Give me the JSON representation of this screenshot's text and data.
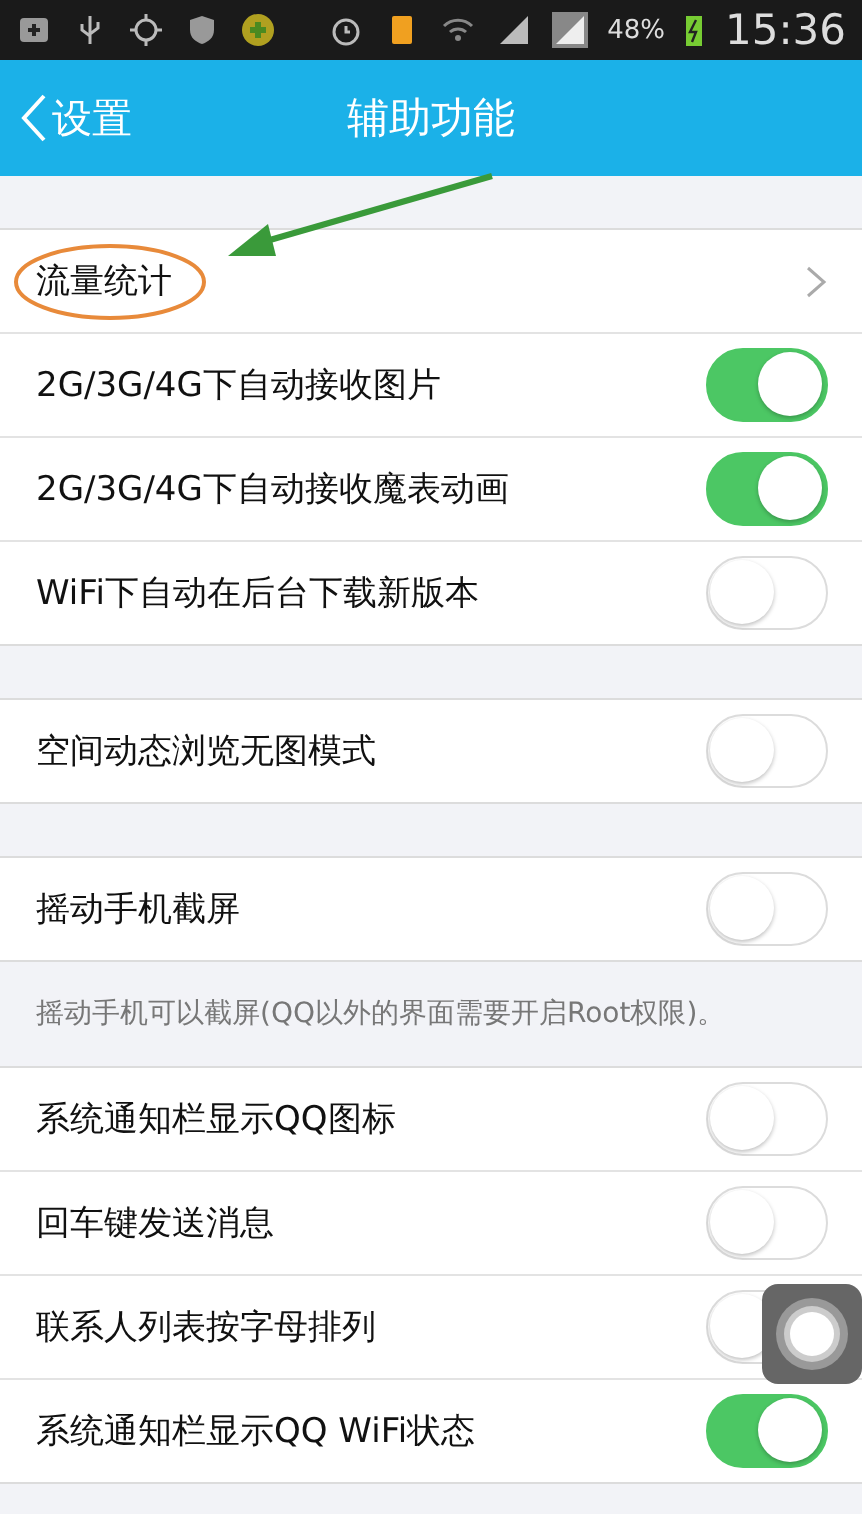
{
  "status_bar": {
    "battery": "48%",
    "time": "15:36"
  },
  "header": {
    "back": "设置",
    "title": "辅助功能"
  },
  "sections": [
    {
      "rows": [
        {
          "kind": "link",
          "label": "流量统计",
          "highlighted": true
        },
        {
          "kind": "toggle",
          "label": "2G/3G/4G下自动接收图片",
          "on": true
        },
        {
          "kind": "toggle",
          "label": "2G/3G/4G下自动接收魔表动画",
          "on": true
        },
        {
          "kind": "toggle",
          "label": "WiFi下自动在后台下载新版本",
          "on": false
        }
      ]
    },
    {
      "rows": [
        {
          "kind": "toggle",
          "label": "空间动态浏览无图模式",
          "on": false
        }
      ]
    },
    {
      "rows": [
        {
          "kind": "toggle",
          "label": "摇动手机截屏",
          "on": false
        }
      ],
      "note": "摇动手机可以截屏(QQ以外的界面需要开启Root权限)。"
    },
    {
      "rows": [
        {
          "kind": "toggle",
          "label": "系统通知栏显示QQ图标",
          "on": false
        },
        {
          "kind": "toggle",
          "label": "回车键发送消息",
          "on": false
        },
        {
          "kind": "toggle",
          "label": "联系人列表按字母排列",
          "on": false
        },
        {
          "kind": "toggle",
          "label": "系统通知栏显示QQ WiFi状态",
          "on": true
        }
      ]
    }
  ]
}
